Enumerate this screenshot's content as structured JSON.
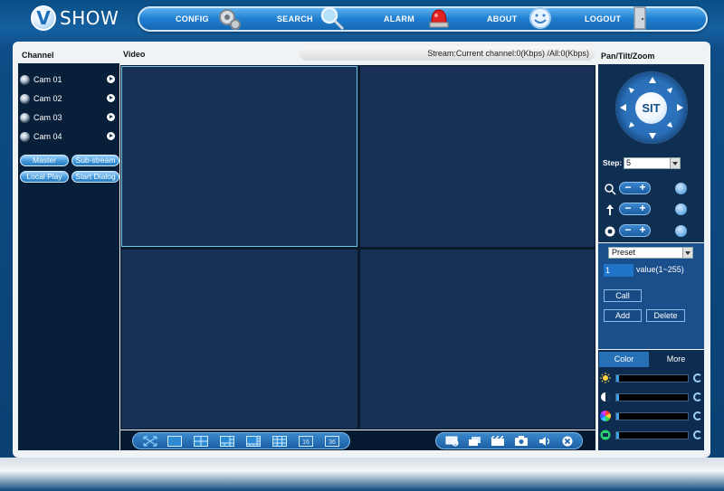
{
  "app": {
    "logo_letter": "V",
    "logo_text": "SHOW"
  },
  "nav": {
    "items": [
      {
        "label": "CONFIG",
        "icon": "gear-icon"
      },
      {
        "label": "SEARCH",
        "icon": "magnifier-icon"
      },
      {
        "label": "ALARM",
        "icon": "siren-icon"
      },
      {
        "label": "ABOUT",
        "icon": "smiley-icon"
      },
      {
        "label": "LOGOUT",
        "icon": "door-icon"
      }
    ]
  },
  "headers": {
    "channel": "Channel",
    "video": "Video",
    "ptz": "Pan/Tilt/Zoom"
  },
  "stream_status": "Stream:Current channel:0(Kbps) /All:0(Kbps)",
  "channels": [
    {
      "label": "Cam 01"
    },
    {
      "label": "Cam 02"
    },
    {
      "label": "Cam 03"
    },
    {
      "label": "Cam 04"
    }
  ],
  "channel_buttons": {
    "master": "Master",
    "sub_stream": "Sub-stream",
    "local_play": "Local Play",
    "start_dialog": "Start Dialog"
  },
  "video_layout": {
    "active_cell": 0,
    "layout_buttons": [
      "fullscreen-icon",
      "layout-1-icon",
      "layout-4-icon",
      "layout-6-icon",
      "layout-8-icon",
      "layout-9-icon",
      "16",
      "36"
    ],
    "action_buttons": [
      "snapshot-icon",
      "multi-window-icon",
      "record-icon",
      "camera-icon",
      "audio-icon",
      "close-icon"
    ]
  },
  "ptz": {
    "center_label": "SIT",
    "step_label": "Step:",
    "step_value": "5",
    "controls": [
      {
        "icon": "zoom-icon",
        "side_icon": "bulb-icon"
      },
      {
        "icon": "focus-icon",
        "side_icon": "wiper-icon"
      },
      {
        "icon": "iris-icon",
        "side_icon": "rotate-icon"
      }
    ]
  },
  "preset": {
    "select_value": "Preset",
    "input_value": "1",
    "range_text": "value(1~255)",
    "call": "Call",
    "add": "Add",
    "delete": "Delete"
  },
  "color_panel": {
    "tabs": [
      "Color",
      "More"
    ],
    "sliders": [
      {
        "icon": "brightness-icon",
        "value": 0
      },
      {
        "icon": "contrast-icon",
        "value": 0
      },
      {
        "icon": "hue-icon",
        "value": 0
      },
      {
        "icon": "saturation-icon",
        "value": 0
      }
    ]
  },
  "colors": {
    "accent": "#1f7ecf",
    "panel_dark": "#071f39",
    "video_cell": "#183056",
    "active_border": "#6ac6e4"
  }
}
